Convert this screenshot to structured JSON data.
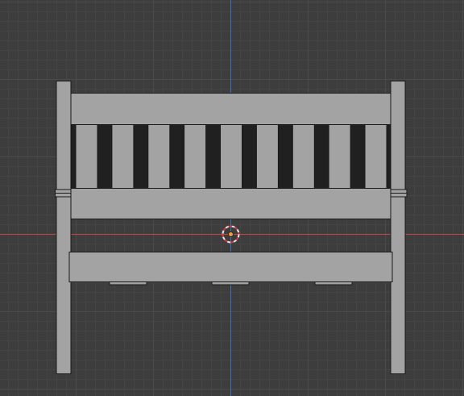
{
  "viewport": {
    "name": "3D Viewport",
    "background_color": "#3d3d3d",
    "grid_minor_color": "#444444",
    "grid_major_color": "#4b4b4b",
    "x_axis_color": "#c8464b",
    "z_axis_color": "#3e6fb8"
  },
  "object": {
    "name": "bench",
    "body_color": "#a3a3a3",
    "outline_color": "#1a1a1a",
    "slat_count": 9,
    "post_count": 2,
    "support_block_count": 3
  },
  "origin_marker": {
    "icon": "3d-cursor-icon",
    "ring_colors": [
      "#e8e8e8",
      "#d03c3c"
    ],
    "center_color": "#f0a030"
  }
}
